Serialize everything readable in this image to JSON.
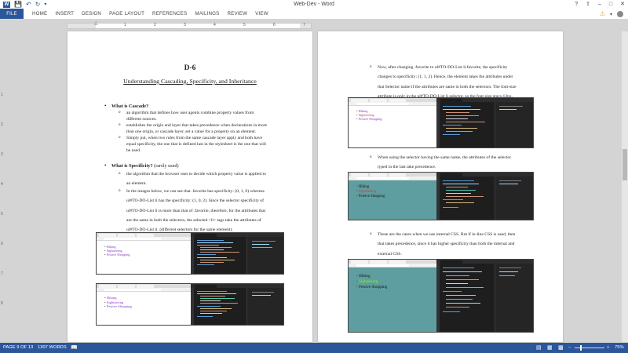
{
  "window": {
    "title": "Web-Dev - Word",
    "quick_access": [
      "save-icon",
      "undo-icon",
      "redo-icon"
    ],
    "controls": [
      "?",
      "–",
      "□",
      "✕"
    ]
  },
  "ribbon": {
    "file_tab": "FILE",
    "tabs": [
      "HOME",
      "INSERT",
      "DESIGN",
      "PAGE LAYOUT",
      "REFERENCES",
      "MAILINGS",
      "REVIEW",
      "VIEW"
    ]
  },
  "ruler": {
    "numbers": [
      "1",
      "2",
      "3",
      "4",
      "5",
      "6",
      "7"
    ],
    "side_numbers": [
      "1",
      "2",
      "3",
      "4",
      "5",
      "6",
      "7",
      "8"
    ]
  },
  "page_left": {
    "heading": "D-6",
    "title": "Understanding Cascading, Specificity, and Inheritance",
    "sections": [
      {
        "label": "What is Cascade?",
        "label_suffix": "",
        "items": [
          [
            "an algorithm that defines how user agents combine property values from",
            "different sources."
          ],
          [
            "establishes the origin and layer that takes precedence when declarations in more",
            "than one origin, or cascade layer, set a value for a property on an element."
          ],
          [
            "Simply put, when two rules from the same cascade layer apply and both have",
            "equal specificity, the one that is defined last in the stylesheet is the one that will",
            "be used."
          ]
        ]
      },
      {
        "label": "What is Specificity?",
        "label_suffix": " (rarely used)",
        "items": [
          [
            "the algorithm that the browser uses to decide which property value is applied to",
            "an element."
          ],
          [
            "In the images below, we can see that .favorite has specificity: (0, 1, 0) whereas",
            "ul#TO-DO-List li has the specificity: (1, 0, 2). Since the selector specificity of",
            "ul#TO-DO-List li is more than that of .favorite, therefore, for the attributes that",
            "are the same in both the selectors, the selected <li> tags take the attributes of",
            "ul#TO-DO-List li. (different selectors for the same element)."
          ]
        ]
      }
    ]
  },
  "page_right": {
    "items": [
      [
        "Now, after changing .favorite to ul#TO-DO-List li.favorite, the specificity",
        "changes to specificity: (1, 1, 2). Hence, the element takes the attributes under",
        "that Selector name if the attributes are same in both the selectors. The font-size",
        "attribute is only in the ul#TO-DO-List li selector, so the font-size stays 12px."
      ],
      [
        "When using the selector having the same name, the attributes of the selector",
        "typed in the last take precedence."
      ],
      [
        "These are the cases when we use internal CSS. But if in-line CSS is used, then",
        "that takes precedence, since it has higher specificity than both the internal and",
        "external CSS."
      ]
    ]
  },
  "screenshot_list": [
    "Hiking",
    "Sightseeing",
    "Festive Shopping"
  ],
  "colors": {
    "accent": "#2b579a",
    "editor_bg": "#1e1e1e",
    "teal_bg": "#5f9ea0",
    "list_purple": "#8a3fc9",
    "list_red": "#d23b3b"
  },
  "status": {
    "page": "PAGE 9 OF 13",
    "words": "1307 WORDS",
    "zoom": "75%"
  }
}
